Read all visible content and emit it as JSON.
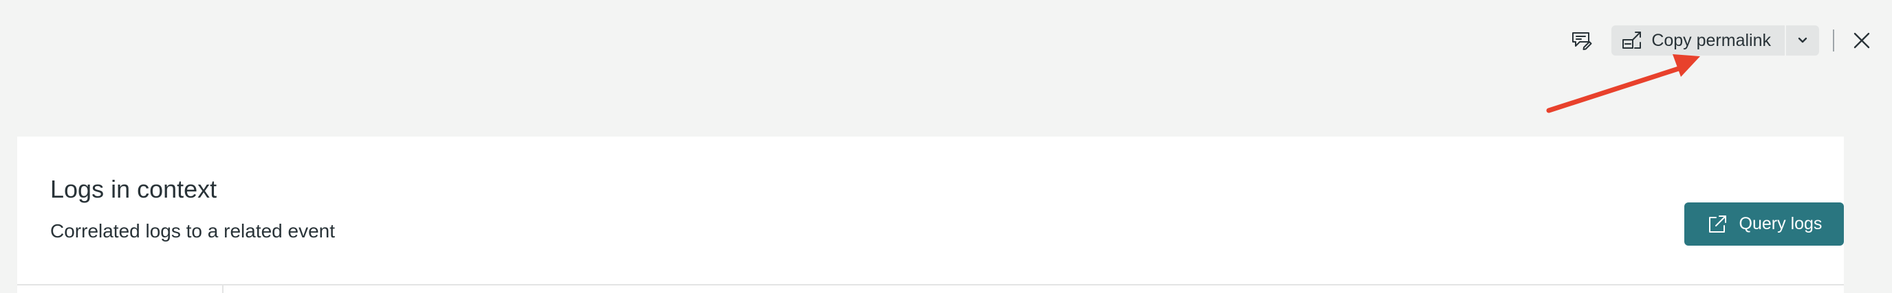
{
  "toolbar": {
    "feedback_icon": "feedback-chat-edit-icon",
    "permalink_label": "Copy permalink",
    "permalink_icon": "external-link-copy-icon",
    "chevron_icon": "chevron-down-icon",
    "close_icon": "close-icon"
  },
  "annotation": {
    "type": "arrow",
    "color": "#e8412c"
  },
  "card": {
    "title": "Logs in context",
    "subtitle": "Correlated logs to a related event",
    "query_button_label": "Query logs",
    "query_button_icon": "external-link-icon",
    "query_button_color": "#2a7680"
  }
}
